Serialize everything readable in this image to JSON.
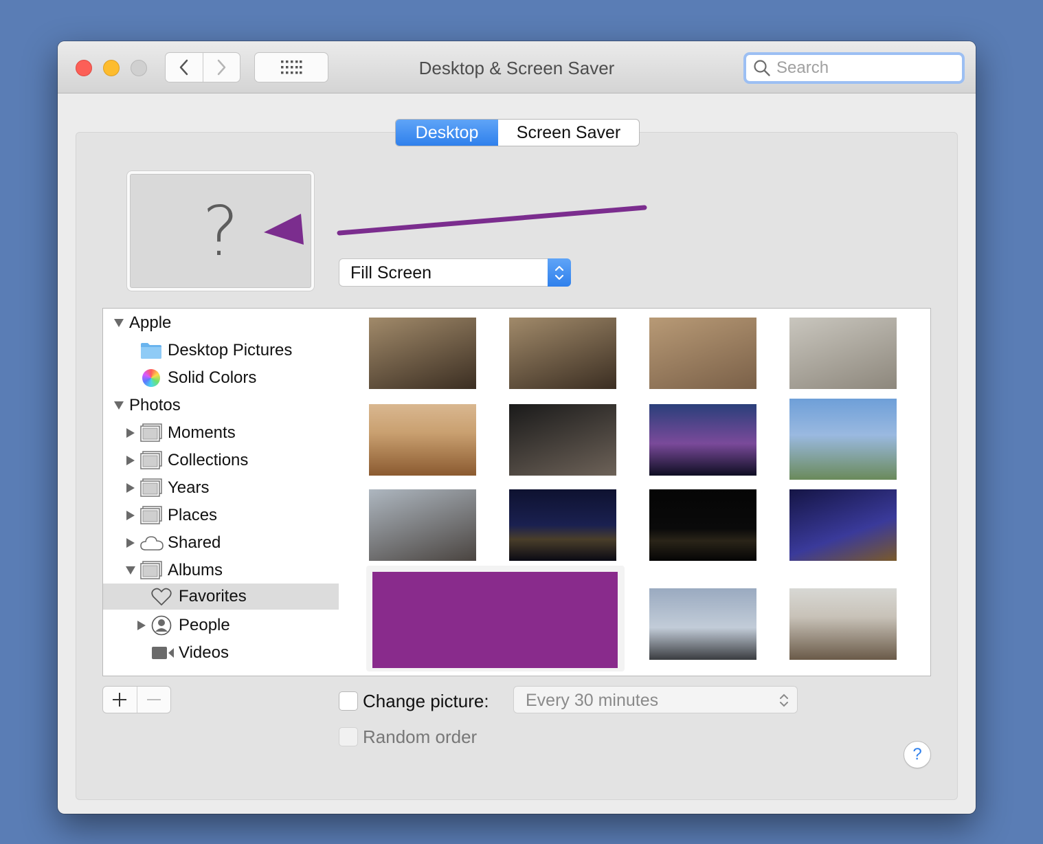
{
  "window": {
    "title": "Desktop & Screen Saver",
    "search_placeholder": "Search"
  },
  "tabs": [
    {
      "label": "Desktop",
      "active": true
    },
    {
      "label": "Screen Saver",
      "active": false
    }
  ],
  "preview": {
    "placeholder_glyph": "?"
  },
  "annotation": {
    "arrow_color": "#7b2d8e"
  },
  "fit_mode": {
    "value": "Fill Screen"
  },
  "sidebar": {
    "items": [
      {
        "label": "Apple",
        "icon": "disclosure-down-icon"
      },
      {
        "label": "Desktop Pictures",
        "icon": "folder-icon"
      },
      {
        "label": "Solid Colors",
        "icon": "color-wheel-icon"
      },
      {
        "label": "Photos",
        "icon": "disclosure-down-icon"
      },
      {
        "label": "Moments",
        "icon": "photo-stack-icon"
      },
      {
        "label": "Collections",
        "icon": "photo-stack-icon"
      },
      {
        "label": "Years",
        "icon": "photo-stack-icon"
      },
      {
        "label": "Places",
        "icon": "photo-stack-icon"
      },
      {
        "label": "Shared",
        "icon": "cloud-icon"
      },
      {
        "label": "Albums",
        "icon": "photo-stack-icon"
      },
      {
        "label": "Favorites",
        "icon": "heart-icon",
        "selected": true
      },
      {
        "label": "People",
        "icon": "person-icon"
      },
      {
        "label": "Videos",
        "icon": "video-camera-icon"
      }
    ]
  },
  "thumbnails": [
    {
      "subject": "white tiger",
      "colors": [
        "#a18a6a",
        "#3b2e22"
      ]
    },
    {
      "subject": "white tiger",
      "colors": [
        "#a18a6a",
        "#3b2e22"
      ]
    },
    {
      "subject": "monkey eating",
      "colors": [
        "#b89a76",
        "#7a6048"
      ]
    },
    {
      "subject": "monkey on pavement",
      "colors": [
        "#c9c6be",
        "#8d877c"
      ]
    },
    {
      "subject": "desert dunes",
      "colors": [
        "#c9a070",
        "#8b5a30"
      ]
    },
    {
      "subject": "monkey on branch",
      "colors": [
        "#1a1a1a",
        "#6d6258"
      ]
    },
    {
      "subject": "lit building at night",
      "colors": [
        "#2a3f7a",
        "#7a4a9a"
      ]
    },
    {
      "subject": "gas station",
      "colors": [
        "#6e9fd8",
        "#6a8a5a"
      ]
    },
    {
      "subject": "cyclists on street",
      "colors": [
        "#aeb7c0",
        "#4a4440"
      ]
    },
    {
      "subject": "city skyline at night",
      "colors": [
        "#0e1230",
        "#4a3e2a"
      ]
    },
    {
      "subject": "dark skyline",
      "colors": [
        "#050505",
        "#2a2418"
      ]
    },
    {
      "subject": "warehouse canal blue lights",
      "colors": [
        "#151545",
        "#3a3a9a"
      ]
    },
    {
      "subject": "selected redacted",
      "colors": [
        "#892b8c",
        "#892b8c"
      ]
    },
    {
      "subject": "palm trees beach",
      "colors": [
        "#9aaac0",
        "#3a3c40"
      ]
    },
    {
      "subject": "stacked stones",
      "colors": [
        "#c8c2b8",
        "#6a5a48"
      ]
    }
  ],
  "change_picture": {
    "label": "Change picture:",
    "interval": "Every 30 minutes"
  },
  "random_order": {
    "label": "Random order"
  },
  "buttons": {
    "add": "+",
    "remove": "−",
    "help": "?"
  }
}
